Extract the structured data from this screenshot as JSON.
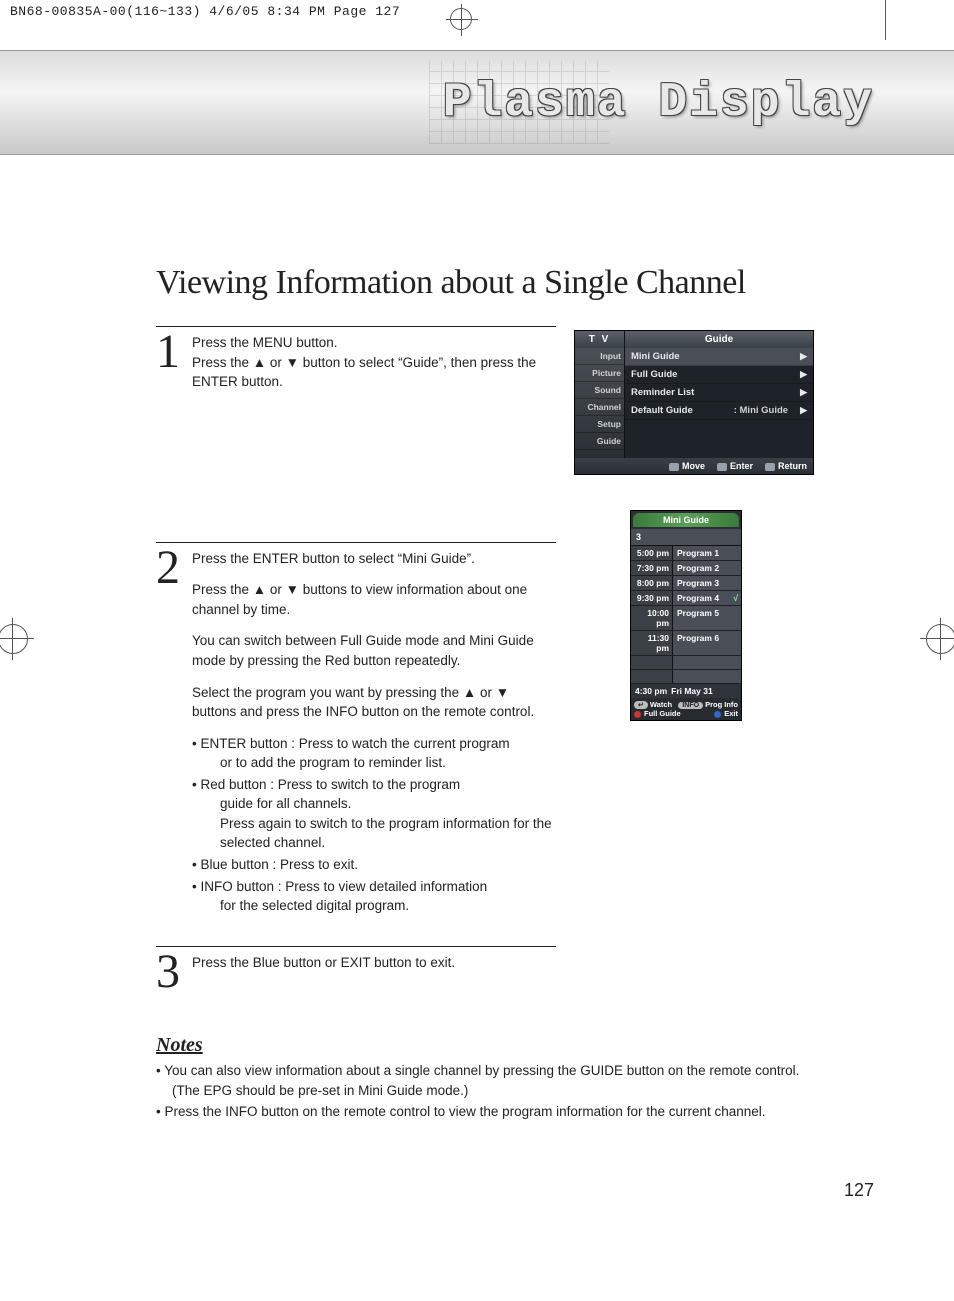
{
  "print_header": "BN68-00835A-00(116~133)  4/6/05  8:34 PM  Page 127",
  "banner_title": "Plasma Display",
  "section_heading": "Viewing Information about a Single Channel",
  "page_number": "127",
  "steps": [
    {
      "num": "1",
      "paras": [
        "Press the MENU button.",
        "Press the ▲ or ▼ button to select “Guide”, then press the ENTER button."
      ]
    },
    {
      "num": "2",
      "paras": [
        "Press the ENTER button to select “Mini Guide”.",
        "Press the ▲ or ▼ buttons to view information about one channel by time.",
        "You can switch between Full Guide mode and Mini Guide mode by pressing the Red button repeatedly.",
        "Select the program you want by pressing the ▲ or ▼ buttons and press the INFO button on the remote control."
      ],
      "bullets": [
        {
          "lead": "• ENTER button : Press to watch the current program",
          "sub": "or to add the program to reminder list."
        },
        {
          "lead": "• Red button : Press to switch to the program",
          "sub": "guide for all channels.",
          "sub2": "Press again to switch to the program information for the selected channel."
        },
        {
          "lead": "• Blue button : Press to exit."
        },
        {
          "lead": "• INFO button : Press to view detailed information",
          "sub": "for the selected digital program."
        }
      ]
    },
    {
      "num": "3",
      "paras": [
        "Press the Blue button or EXIT button to exit."
      ]
    }
  ],
  "notes_heading": "Notes",
  "notes": [
    "• You can also view information about a single channel by pressing the GUIDE button on the remote control. (The EPG should be pre-set in Mini Guide mode.)",
    "• Press the INFO button on the remote control to view the program information for the current channel."
  ],
  "osd1": {
    "tv": "T V",
    "header": "Guide",
    "side": [
      "Input",
      "Picture",
      "Sound",
      "Channel",
      "Setup",
      "Guide"
    ],
    "rows": [
      {
        "label": "Mini Guide",
        "sel": true
      },
      {
        "label": "Full Guide"
      },
      {
        "label": "Reminder List"
      },
      {
        "label": "Default Guide",
        "value": ": Mini Guide"
      }
    ],
    "footer": {
      "move": "Move",
      "enter": "Enter",
      "return": "Return"
    }
  },
  "osd2": {
    "title": "Mini Guide",
    "channel": "3",
    "items": [
      {
        "time": "5:00 pm",
        "prog": "Program 1"
      },
      {
        "time": "7:30 pm",
        "prog": "Program 2"
      },
      {
        "time": "8:00 pm",
        "prog": "Program 3"
      },
      {
        "time": "9:30 pm",
        "prog": "Program 4",
        "sel": true
      },
      {
        "time": "10:00 pm",
        "prog": "Program 5"
      },
      {
        "time": "11:30 pm",
        "prog": "Program 6"
      }
    ],
    "status_time": "4:30 pm",
    "status_date": "Fri May 31",
    "foot": {
      "watch": "Watch",
      "info_pill": "INFO",
      "prog_info": "Prog Info",
      "full_guide": "Full Guide",
      "exit": "Exit"
    }
  }
}
